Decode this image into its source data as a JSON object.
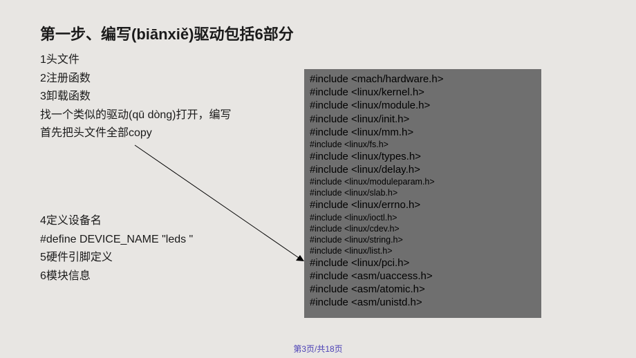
{
  "title": "第一步、编写(biānxiě)驱动包括6部分",
  "lines1": {
    "l1": "1头文件",
    "l2": "2注册函数",
    "l3": "3卸载函数",
    "l4": "找一个类似的驱动(qū dòng)打开，编写",
    "l5": "首先把头文件全部copy"
  },
  "lines2": {
    "l1": "4定义设备名",
    "l2": "#define DEVICE_NAME \"leds \"",
    "l3": "5硬件引脚定义",
    "l4": "6模块信息"
  },
  "code": {
    "c1": "#include <mach/hardware.h>",
    "c2": "#include <linux/kernel.h>",
    "c3": "#include <linux/module.h>",
    "c4": "#include <linux/init.h>",
    "c5": "#include <linux/mm.h>",
    "c6": "#include <linux/fs.h>",
    "c7": "#include <linux/types.h>",
    "c8": "#include <linux/delay.h>",
    "c9": "#include <linux/moduleparam.h>",
    "c10": "#include <linux/slab.h>",
    "c11": "#include <linux/errno.h>",
    "c12": "#include <linux/ioctl.h>",
    "c13": "#include <linux/cdev.h>",
    "c14": "#include <linux/string.h>",
    "c15": "#include <linux/list.h>",
    "c16": "#include <linux/pci.h>",
    "c17": "#include <asm/uaccess.h>",
    "c18": "#include <asm/atomic.h>",
    "c19": "#include <asm/unistd.h>"
  },
  "footer": "第3页/共18页"
}
